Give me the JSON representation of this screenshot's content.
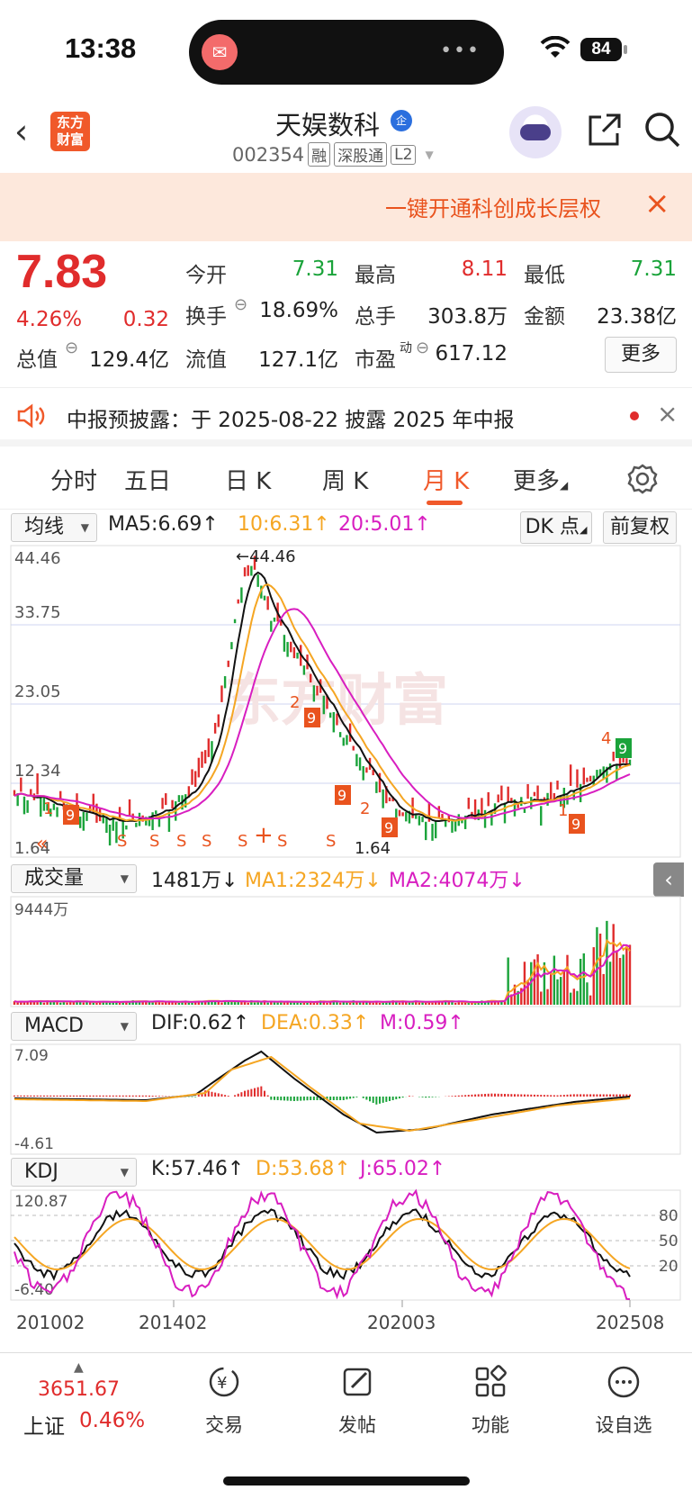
{
  "status_bar": {
    "time": "13:38",
    "battery": "84"
  },
  "header": {
    "stock_name": "天娱数科",
    "code": "002354",
    "tags": [
      "融",
      "深股通",
      "L2"
    ],
    "logo_text": "东方财富"
  },
  "banner": {
    "text": "一键开通科创成长层权"
  },
  "quote": {
    "price": "7.83",
    "pct": "4.26%",
    "change": "0.32",
    "open_label": "今开",
    "open": "7.31",
    "high_label": "最高",
    "high": "8.11",
    "low_label": "最低",
    "low": "7.31",
    "turnover_label": "换手",
    "turnover": "18.69%",
    "volume_label": "总手",
    "volume": "303.8万",
    "amount_label": "金额",
    "amount": "23.38亿",
    "mcap_label": "总值",
    "mcap": "129.4亿",
    "float_label": "流值",
    "float": "127.1亿",
    "pe_label": "市盈",
    "pe_sup": "动",
    "pe": "617.12",
    "more": "更多"
  },
  "notice": {
    "text": "中报预披露：于 2025-08-22 披露 2025 年中报"
  },
  "tabs": [
    "分时",
    "五日",
    "日 K",
    "周 K",
    "月 K",
    "更多"
  ],
  "active_tab": "月 K",
  "ma_row": {
    "selector": "均线",
    "ma5": "MA5:6.69↑",
    "ma10": "10:6.31↑",
    "ma20": "20:5.01↑",
    "dk": "DK 点",
    "fq": "前复权"
  },
  "main_chart": {
    "y_ticks": [
      "44.46",
      "33.75",
      "23.05",
      "12.34",
      "1.64"
    ],
    "max_label": "←44.46",
    "min_label": "1.64",
    "watermark": "东方财富"
  },
  "vol_row": {
    "selector": "成交量",
    "vol": "1481万↓",
    "ma1": "MA1:2324万↓",
    "ma2": "MA2:4074万↓",
    "top_tick": "9444万"
  },
  "macd_row": {
    "selector": "MACD",
    "dif": "DIF:0.62↑",
    "dea": "DEA:0.33↑",
    "m": "M:0.59↑",
    "top_tick": "7.09",
    "bottom_tick": "-4.61"
  },
  "kdj_row": {
    "selector": "KDJ",
    "k": "K:57.46↑",
    "d": "D:53.68↑",
    "j": "J:65.02↑",
    "top_tick": "120.87",
    "bottom_tick": "-6.40",
    "right_ticks": [
      "80",
      "50",
      "20"
    ]
  },
  "x_axis": [
    "201002",
    "201402",
    "202003",
    "202508"
  ],
  "bottom_bar": {
    "index_value": "3651.67",
    "index_name": "上证",
    "index_pct": "0.46%",
    "items": [
      "交易",
      "发帖",
      "功能",
      "设自选"
    ]
  },
  "colors": {
    "up": "#e02c2c",
    "down": "#1aa33a",
    "accent": "#f0592a",
    "ma10": "#f5a623",
    "ma20": "#d81ec0"
  }
}
